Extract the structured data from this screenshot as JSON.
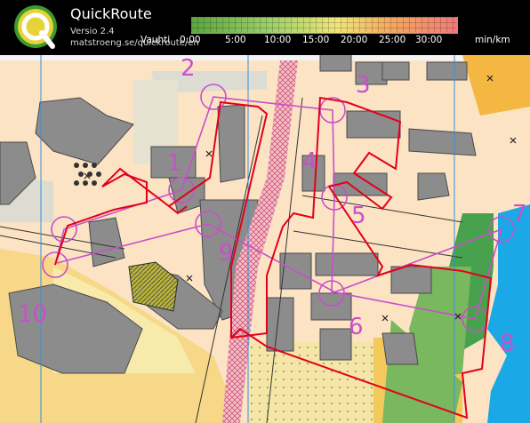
{
  "header": {
    "app_name": "QuickRoute",
    "version": "Versio 2.4",
    "url": "matstroeng.se/quickroute/en"
  },
  "pace_scale": {
    "label": "Vauhti",
    "ticks": [
      "0:00",
      "5:00",
      "10:00",
      "15:00",
      "20:00",
      "25:00",
      "30:00"
    ],
    "unit": "min/km",
    "colors": [
      "#5ca640",
      "#9fd06a",
      "#f0e57a",
      "#f4a860",
      "#f07a7a"
    ]
  },
  "map": {
    "controls": [
      "1",
      "2",
      "3",
      "4",
      "5",
      "6",
      "7",
      "8",
      "9",
      "10"
    ],
    "colors": {
      "background": "#fbe3c4",
      "building": "#8c8c8c",
      "water": "#1aa9e6",
      "vegetation": "#48a24d",
      "route_good": "#e3001b",
      "course": "#c94fc9"
    }
  }
}
